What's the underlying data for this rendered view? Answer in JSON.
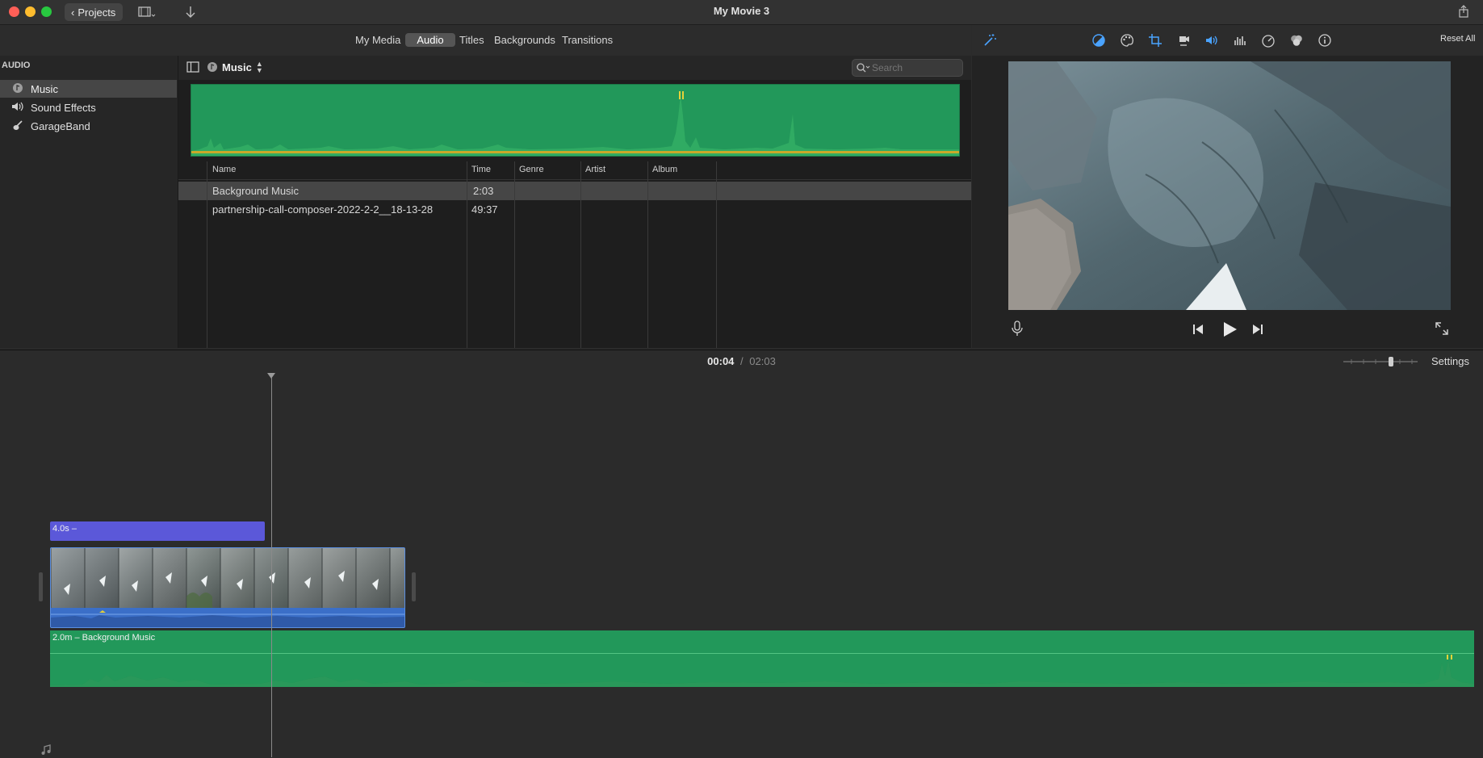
{
  "titlebar": {
    "projects_label": "Projects",
    "window_title": "My Movie 3"
  },
  "browser": {
    "tabs": [
      {
        "label": "My Media",
        "active": false
      },
      {
        "label": "Audio",
        "active": true
      },
      {
        "label": "Titles",
        "active": false
      },
      {
        "label": "Backgrounds",
        "active": false
      },
      {
        "label": "Transitions",
        "active": false
      }
    ],
    "source_popup": "Music",
    "search_placeholder": "Search"
  },
  "sidebar": {
    "heading": "AUDIO",
    "items": [
      {
        "label": "Music",
        "icon": "music-note-icon",
        "selected": true
      },
      {
        "label": "Sound Effects",
        "icon": "speaker-icon",
        "selected": false
      },
      {
        "label": "GarageBand",
        "icon": "guitar-icon",
        "selected": false
      }
    ]
  },
  "list": {
    "columns": [
      "Name",
      "Time",
      "Genre",
      "Artist",
      "Album"
    ],
    "rows": [
      {
        "name": "Background Music",
        "time": "2:03",
        "genre": "",
        "artist": "",
        "album": "",
        "selected": true
      },
      {
        "name": "partnership-call-composer-2022-2-2__18-13-28",
        "time": "49:37",
        "genre": "",
        "artist": "",
        "album": "",
        "selected": false
      }
    ]
  },
  "viewer": {
    "reset_all": "Reset All",
    "tools": [
      "magic-wand-icon",
      "color-balance-icon",
      "color-palette-icon",
      "crop-icon",
      "stabilization-icon",
      "volume-icon",
      "equalizer-icon",
      "speed-icon",
      "filter-icon",
      "info-icon"
    ]
  },
  "timeline": {
    "current_time": "00:04",
    "separator": "/",
    "total_time": "02:03",
    "settings_label": "Settings",
    "title_clip_label": "4.0s –",
    "music_clip_label": "2.0m – Background Music"
  },
  "colors": {
    "audio_green": "#22985a",
    "title_purple": "#5b58d9",
    "clip_blue": "#3b6fc8",
    "accent_blue": "#4aa3ff"
  }
}
